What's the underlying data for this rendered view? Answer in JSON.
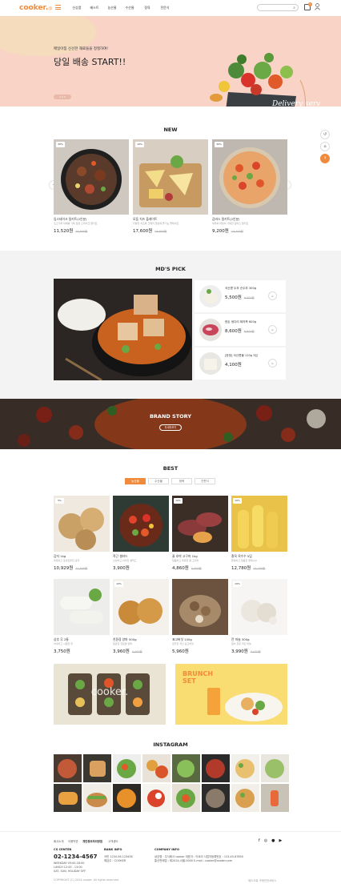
{
  "header": {
    "logo": "cooker.",
    "nav": [
      "신상품",
      "베스트",
      "농산물",
      "수산물",
      "정육",
      "전문식"
    ],
    "cart_count": "0"
  },
  "hero": {
    "subtitle": "매일아침 신선한 재료들을 정질하여!",
    "title": "당일 배송 START!!",
    "pager": "1 2 3",
    "script_text": "Delivery service"
  },
  "new": {
    "title": "NEW",
    "items": [
      {
        "badge": "30%",
        "name": "임스테이크 밀키트(2인분)",
        "desc": "소고기와 야채를 가득 담은 스테이크 밀키트",
        "price": "11,520원",
        "old": "16,800원"
      },
      {
        "badge": "10%",
        "name": "모둠 치즈 플레이트",
        "desc": "다양한 치즈와 크래커 한번에 즐기는 플레이트",
        "price": "17,600원",
        "old": "19,600원"
      },
      {
        "badge": "30%",
        "name": "감바스 밀키트(2인분)",
        "desc": "새우와 마늘이 가득한 감바스 밀키트",
        "price": "9,200원",
        "old": "13,100원"
      }
    ]
  },
  "md": {
    "title": "MD'S PICK",
    "items": [
      {
        "name": "국산콩 두부 순두부 300g",
        "price": "5,500원",
        "old": "6,500원"
      },
      {
        "name": "한돈 생다리 돼지목 600g",
        "price": "8,600원",
        "old": "9,800원"
      },
      {
        "name": "[한정] 국산콩물 120g 3입",
        "price": "4,100원",
        "old": ""
      }
    ]
  },
  "brand": {
    "title": "BRAND STORY",
    "button": "자세히보기"
  },
  "best": {
    "title": "BEST",
    "tabs": [
      "농산물",
      "수산물",
      "정육",
      "간편식"
    ],
    "items": [
      {
        "badge": "5%",
        "name": "감자 1kg",
        "desc": "촉촉하고 포슬포슬한 감자",
        "price": "10,929원",
        "old": "11,500원"
      },
      {
        "badge": "",
        "name": "적근 샐러드",
        "desc": "신선하고 아삭한 샐러드",
        "price": "3,900원",
        "old": ""
      },
      {
        "badge": "10%",
        "name": "꿀 호박 고구마 1kg",
        "desc": "달콤하고 촉촉한 꿀 고구마",
        "price": "4,860원",
        "old": "5,400원"
      },
      {
        "badge": "10%",
        "name": "찰옥 옥수수 5입",
        "desc": "쫀득하고 달콤한 찰옥수수",
        "price": "12,780원",
        "old": "14,200원"
      },
      {
        "badge": "",
        "name": "상추 무 2통",
        "desc": "아삭하고 시원한 무",
        "price": "3,750원",
        "old": ""
      },
      {
        "badge": "10%",
        "name": "친환경 양파 500g",
        "desc": "달큰한 친환경 양파",
        "price": "3,960원",
        "old": "4,400원"
      },
      {
        "badge": "",
        "name": "표고버섯 100g",
        "desc": "향긋한 국산 표고버섯",
        "price": "5,960원",
        "old": ""
      },
      {
        "badge": "10%",
        "name": "깐 마늘 300g",
        "desc": "알이 굵은 국산 마늘",
        "price": "3,990원",
        "old": "4,430원"
      }
    ]
  },
  "banners": {
    "left": "cooker.",
    "right_title": "BRUNCH SET"
  },
  "instagram": {
    "title": "INSTAGRAM"
  },
  "footer": {
    "links": [
      "회사소개",
      "이용약관",
      "개인정보처리방침",
      "고객센터"
    ],
    "cs_head": "CS CENTER",
    "phone": "02-1234-4567",
    "cs_hours": "WEEKDAY 09:00-18:00",
    "cs_lunch": "LUNCH 12:00 - 13:00",
    "cs_off": "SAT, SUN, HOLIDAY OFF",
    "bank_head": "BANK INFO",
    "bank1": "국민 1234-56-123456",
    "bank2": "예금주 : COOKER",
    "company_head": "COMPANY INFO",
    "company1": "상호명 : 주식회사 cooker   대표자 : 이요리   사업자등록번호 : 123-45-67890",
    "company2": "통신판매업 : 제2024-서울-0000   E-mail : cooker@cooker.com",
    "copyright": "COPYRIGHT (C) 2024 cooker. All rights reserved.",
    "escrow": "에스크로 구매안전서비스"
  },
  "colors": {
    "accent": "#f08a3c",
    "hero_bg": "#f8d3c6",
    "gray_bg": "#f3f3f3"
  }
}
